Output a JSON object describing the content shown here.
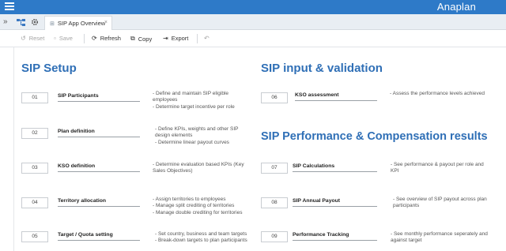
{
  "app": {
    "brand": "Anaplan"
  },
  "tabstrip": {
    "tab_label": "SIP App Overview",
    "tab_close": "×",
    "collapse_glyph": "»"
  },
  "toolbar": {
    "reset_label": "Reset",
    "save_label": "Save",
    "refresh_label": "Refresh",
    "copy_label": "Copy",
    "export_label": "Export"
  },
  "sections": {
    "setup_title": "SIP Setup",
    "input_title": "SIP input & validation",
    "perf_title": "SIP Performance & Compensation results"
  },
  "items": [
    {
      "num": "01",
      "label": "SIP Participants",
      "desc": [
        "- Define and maintain SIP eligible",
        "employees",
        "- Determine target incentive per role"
      ]
    },
    {
      "num": "02",
      "label": "Plan definition",
      "desc": [
        "- Define KPIs, weights and other SIP",
        "design elements",
        "- Determine linear payout curves"
      ]
    },
    {
      "num": "03",
      "label": "KSO definition",
      "desc": [
        "- Determine evaluation based KPIs (Key",
        "Sales Objectives)"
      ]
    },
    {
      "num": "04",
      "label": "Territory allocation",
      "desc": [
        "- Assign territories to employees",
        "- Manage split crediting of territories",
        "- Manage double crediting for territories"
      ]
    },
    {
      "num": "05",
      "label": "Target / Quota setting",
      "desc": [
        "- Set country, business and team targets",
        "- Break-down targets to plan participants"
      ]
    },
    {
      "num": "06",
      "label": "KSO assessment",
      "desc": [
        "- Assess the performance levels achieved"
      ]
    },
    {
      "num": "07",
      "label": "SIP Calculations",
      "desc": [
        "- See performance & payout per role and",
        "KPI"
      ]
    },
    {
      "num": "08",
      "label": "SIP Annual Payout",
      "desc": [
        "- See overview of SIP payout across plan",
        "participants"
      ]
    },
    {
      "num": "09",
      "label": "Performance Tracking",
      "desc": [
        "- See monthly performance seperately and",
        "against target"
      ]
    }
  ],
  "colors": {
    "topbar": "#2e7ac8",
    "heading": "#2f6fb6",
    "tabstrip": "#e9eef3"
  }
}
